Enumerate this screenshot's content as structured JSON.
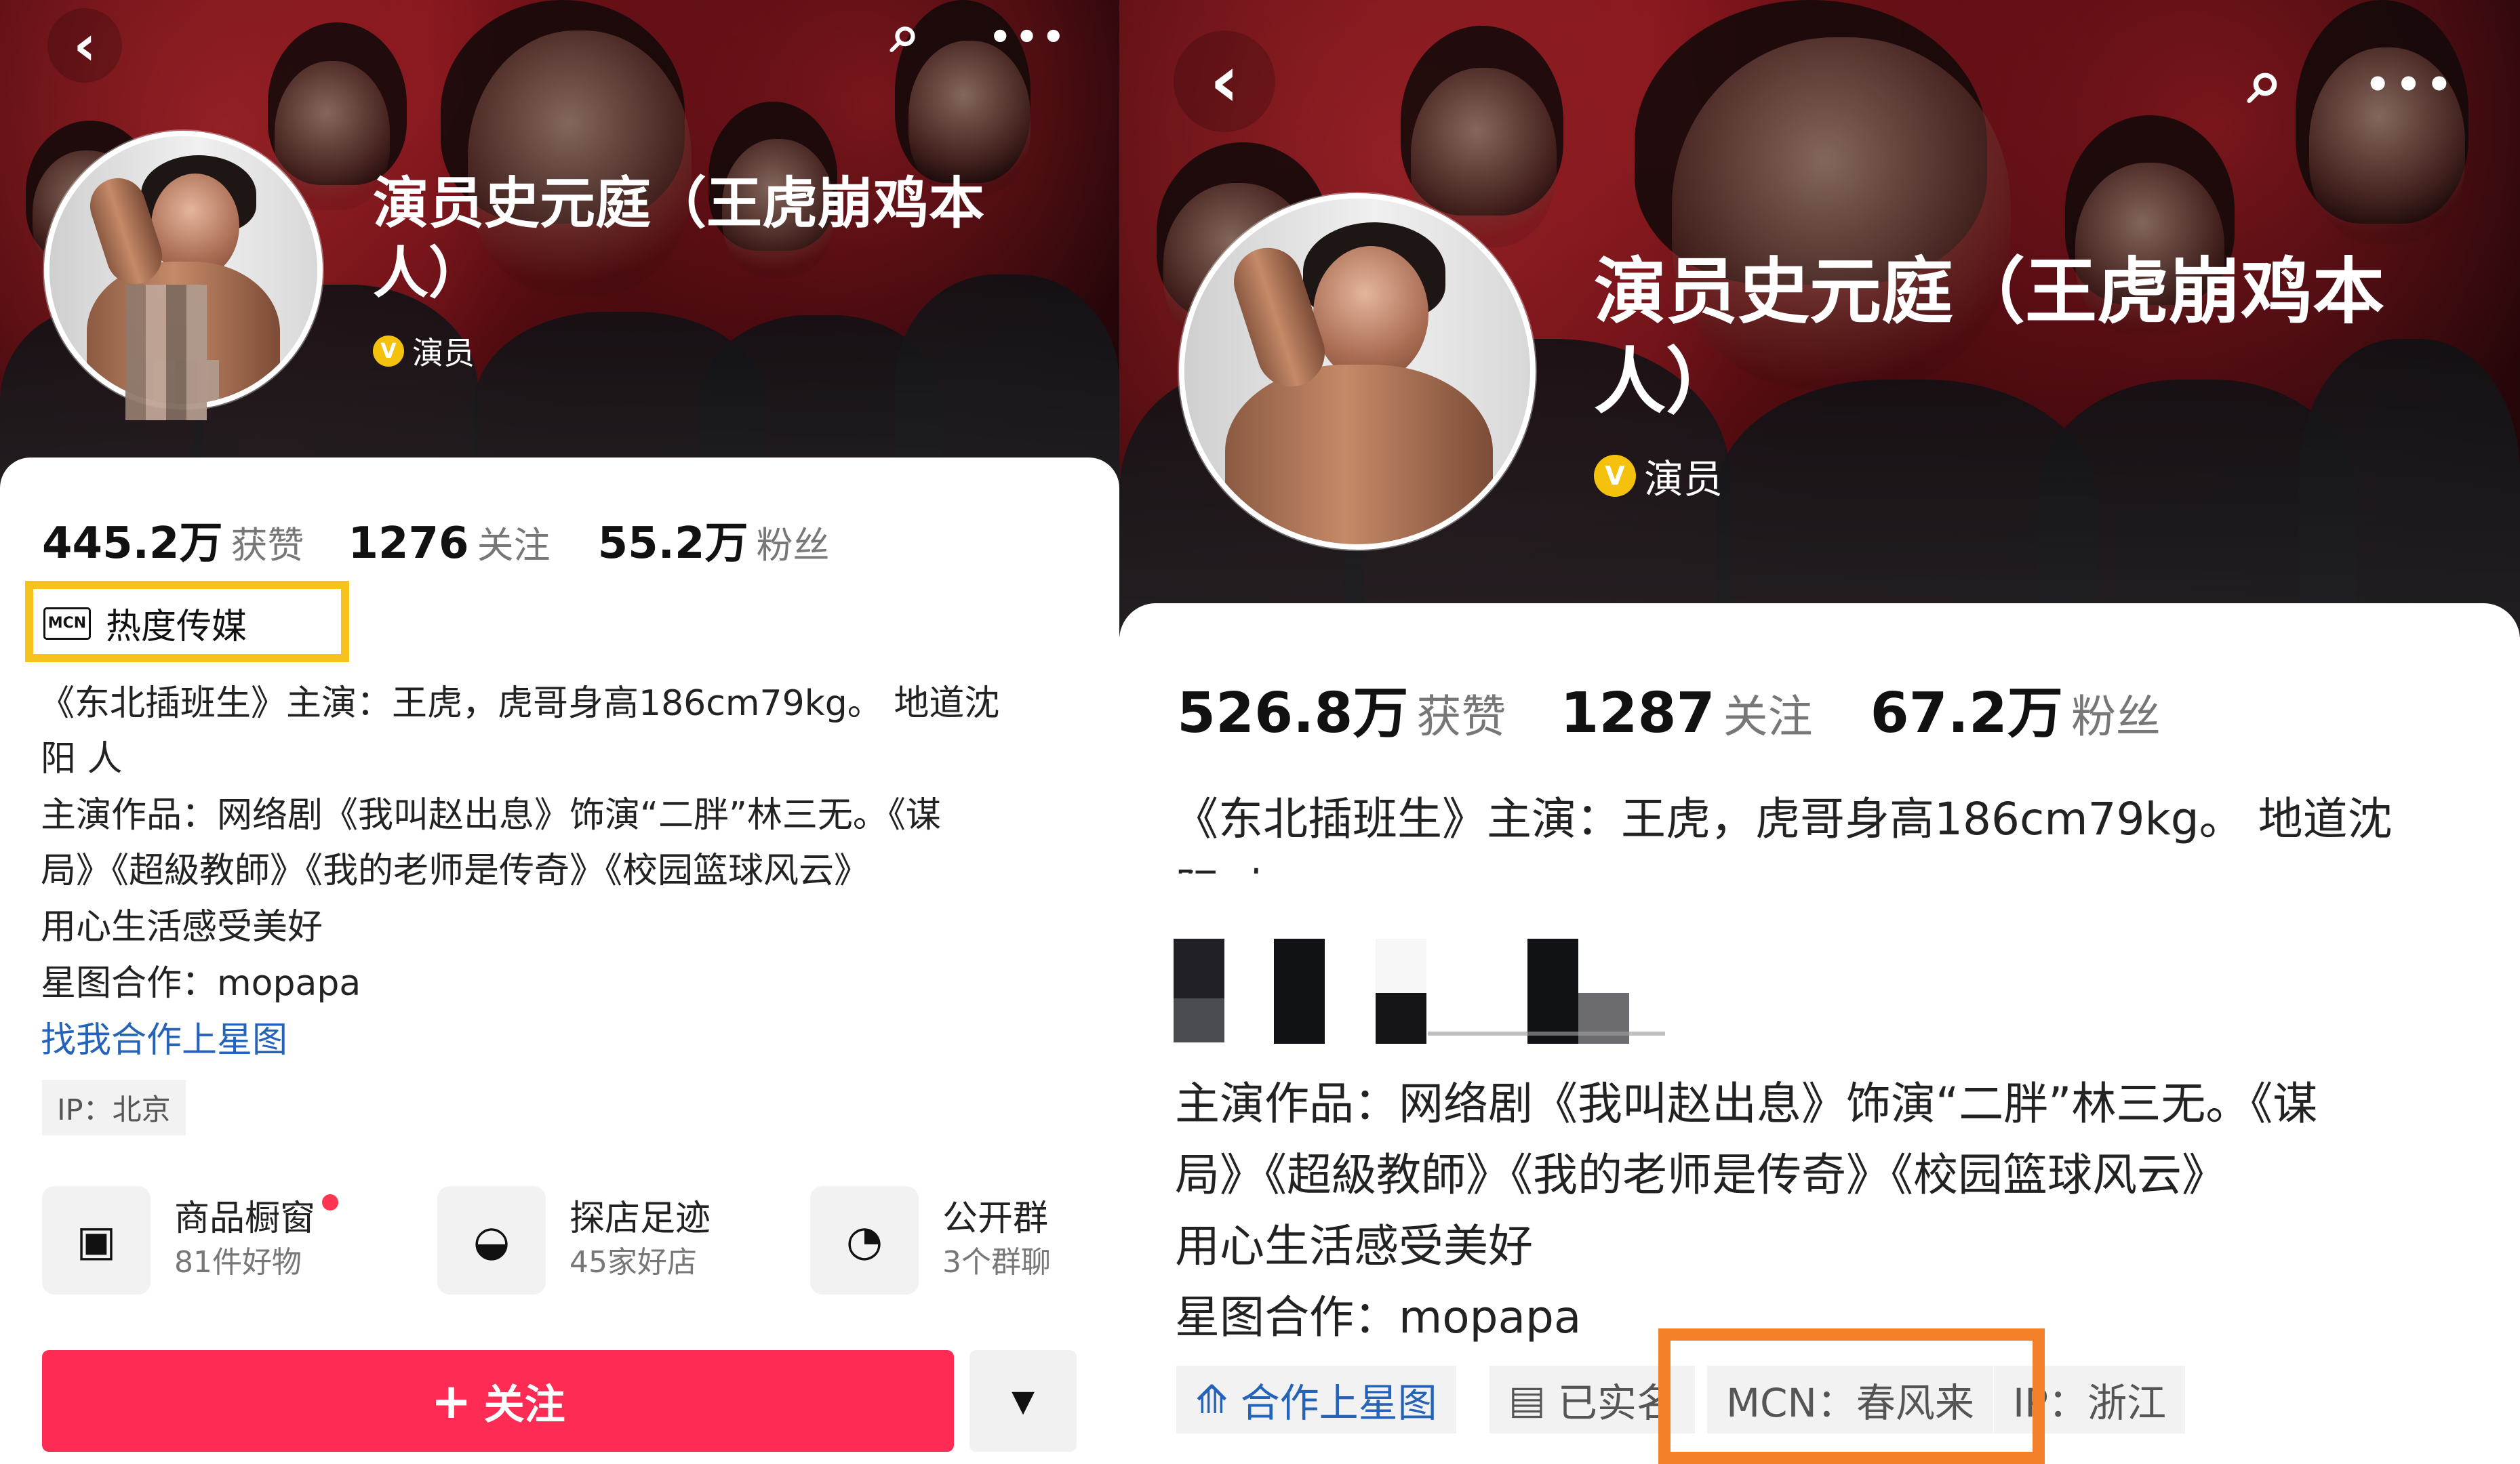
{
  "colors": {
    "banner_red": "#8f171f",
    "accent_pink": "#fe2c55",
    "link_blue": "#2563b8",
    "verified_gold": "#f4c20d",
    "left_highlight": "#f5c31b",
    "right_highlight": "#f4812a"
  },
  "icons": {
    "back": "‹",
    "search": "⌕",
    "more": "•••",
    "verified": "V",
    "mcn": "MCN",
    "shop": "▣",
    "store": "◒",
    "group": "◔",
    "plus": "+",
    "dropdown": "▼",
    "xingtu": "⟰",
    "id_card": "▤"
  },
  "left": {
    "title_line1": "演员史元庭（王虎崩鸡本",
    "title_line2": "人）",
    "verification": "演员",
    "stats": {
      "likes_value": "445.2万",
      "likes_label": "获赞",
      "following_value": "1276",
      "following_label": "关注",
      "followers_value": "55.2万",
      "followers_label": "粉丝"
    },
    "mcn_label": "MCN",
    "mcn_name": "热度传媒",
    "bio_line1": "《东北插班生》主演：王虎，虎哥身高186cm79kg。 地道沈",
    "bio_line2": "阳 人",
    "bio_line3": "主演作品：网络剧《我叫赵出息》饰演“二胖”林三无。《谋",
    "bio_line4": "局》《超級教師》《我的老师是传奇》《校园篮球风云》",
    "bio_line5": "用心生活感受美好",
    "bio_line6": "星图合作：mopapa",
    "link": "找我合作上星图",
    "ip": "IP：北京",
    "entries": [
      {
        "title": "商品橱窗",
        "subtitle": "81件好物"
      },
      {
        "title": "探店足迹",
        "subtitle": "45家好店"
      },
      {
        "title": "公开群",
        "subtitle": "3个群聊"
      }
    ],
    "follow_label": "关注"
  },
  "right": {
    "title_line1": "演员史元庭（王虎崩鸡本",
    "title_line2": "人）",
    "verification": "演员",
    "stats": {
      "likes_value": "526.8万",
      "likes_label": "获赞",
      "following_value": "1287",
      "following_label": "关注",
      "followers_value": "67.2万",
      "followers_label": "粉丝"
    },
    "bio_line1": "《东北插班生》主演：王虎，虎哥身高186cm79kg。 地道沈",
    "bio_line2": "阳 人",
    "bio_line3": "主演作品：网络剧《我叫赵出息》饰演“二胖”林三无。《谋",
    "bio_line4": "局》《超級教師》《我的老师是传奇》《校园篮球风云》",
    "bio_line5": "用心生活感受美好",
    "bio_line6": "星图合作：mopapa",
    "chips": {
      "xingtu": "合作上星图",
      "verified": "已实名",
      "mcn": "MCN：春风来",
      "ip": "IP：浙江"
    }
  }
}
